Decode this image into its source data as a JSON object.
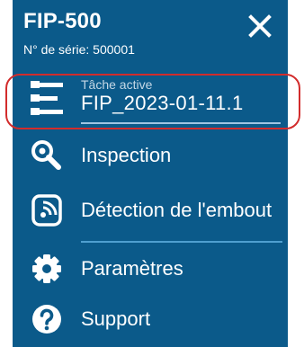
{
  "header": {
    "title": "FIP-500",
    "serial": "N° de série: 500001",
    "close_icon": "close-icon"
  },
  "active_task": {
    "caption": "Tâche active",
    "value": "FIP_2023-01-11.1",
    "icon": "task-list-icon"
  },
  "menu": {
    "items": [
      {
        "label": "Inspection",
        "icon": "magnifier-icon"
      },
      {
        "label": "Détection de l'embout",
        "icon": "tip-detection-icon"
      },
      {
        "label": "Paramètres",
        "icon": "gear-icon"
      },
      {
        "label": "Support",
        "icon": "help-icon"
      }
    ]
  },
  "colors": {
    "menu_background": "#0b5a8a",
    "highlight_outline": "#d22c2c",
    "text": "#ffffff"
  }
}
